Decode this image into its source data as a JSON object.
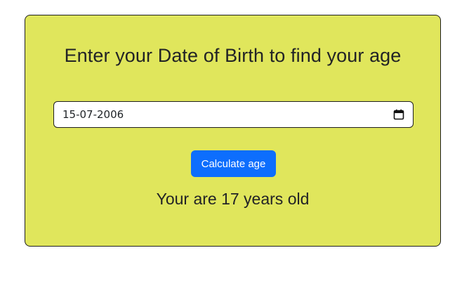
{
  "form": {
    "title": "Enter your Date of Birth to find your age",
    "date_value": "15-07-2006",
    "calendar_icon": "calendar-icon",
    "button_label": "Calculate age",
    "result_text": "Your are 17 years old"
  },
  "colors": {
    "card_background": "#e0e65c",
    "button_background": "#0d6efd",
    "text": "#222326"
  }
}
